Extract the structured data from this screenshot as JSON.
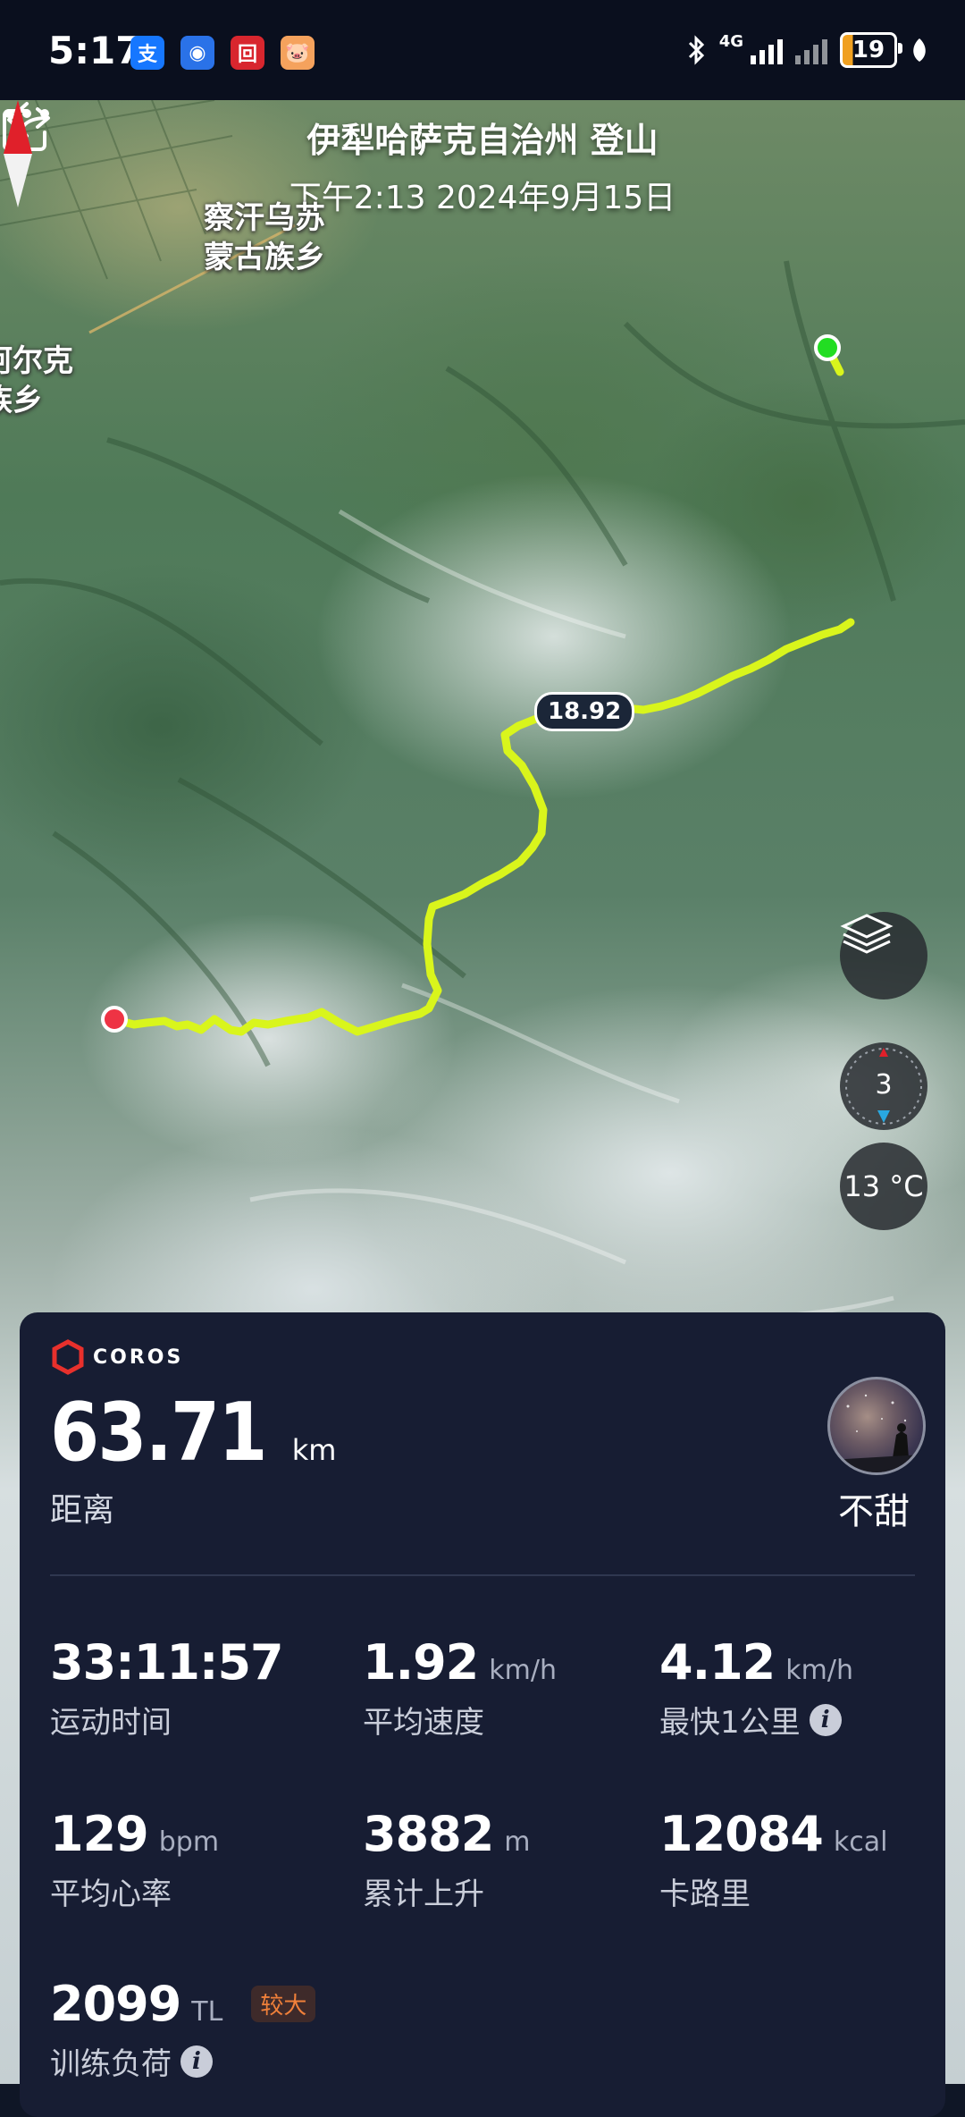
{
  "status_bar": {
    "time": "5:17",
    "apps": [
      {
        "icon": "alipay-icon",
        "glyph": "支",
        "color": "#1677ff"
      },
      {
        "icon": "app-shield-icon",
        "glyph": "◉",
        "color": "#2a72e8"
      },
      {
        "icon": "bank-icon",
        "glyph": "回",
        "color": "#d8262e"
      },
      {
        "icon": "pig-app-icon",
        "glyph": "🐷",
        "color": "#f5a25d"
      }
    ],
    "network_label": "4G",
    "battery": "19"
  },
  "header": {
    "title": "伊犁哈萨克自治州 登山",
    "subtitle": "下午2:13 2024年9月15日"
  },
  "map": {
    "place_labels": [
      "察汗乌苏",
      "蒙古族乡",
      "阿尔克",
      "族乡"
    ],
    "distance_marker": "18.92",
    "compass_level": "3",
    "compass_north": "N",
    "temperature": "13 °C",
    "route_color": "#d9f51c",
    "start_color": "#22dd22",
    "end_color": "#ee3344"
  },
  "card": {
    "brand": "COROS",
    "distance": {
      "value": "63.71",
      "unit": "km",
      "label": "距离"
    },
    "user": {
      "name": "不甜"
    },
    "stats": [
      {
        "value": "33:11:57",
        "unit": "",
        "label": "运动时间",
        "info": false
      },
      {
        "value": "1.92",
        "unit": "km/h",
        "label": "平均速度",
        "info": false
      },
      {
        "value": "4.12",
        "unit": "km/h",
        "label": "最快1公里",
        "info": true
      },
      {
        "value": "129",
        "unit": "bpm",
        "label": "平均心率",
        "info": false
      },
      {
        "value": "3882",
        "unit": "m",
        "label": "累计上升",
        "info": false
      },
      {
        "value": "12084",
        "unit": "kcal",
        "label": "卡路里",
        "info": false
      },
      {
        "value": "2099",
        "unit": "TL",
        "label": "训练负荷",
        "info": true,
        "badge": "较大"
      }
    ]
  }
}
